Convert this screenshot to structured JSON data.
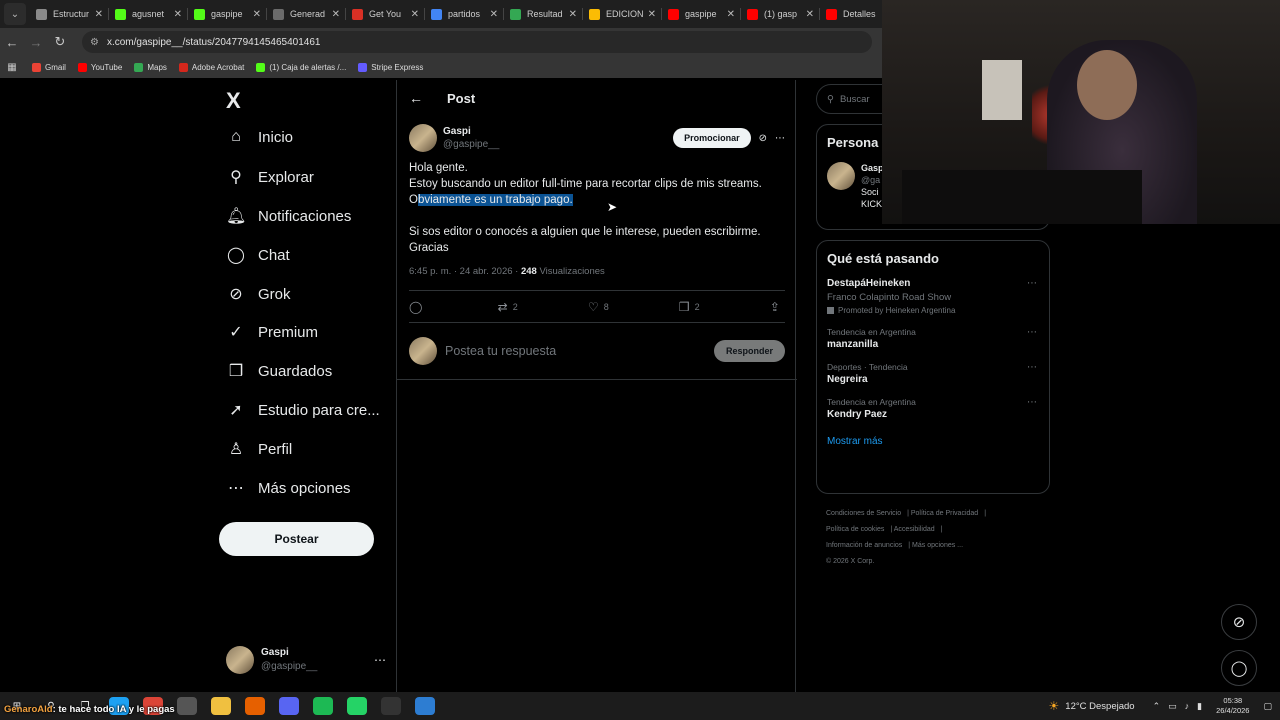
{
  "browser": {
    "tabs": [
      {
        "title": "Estructur",
        "color": "#8a8a8a"
      },
      {
        "title": "agusnet",
        "color": "#53fc18"
      },
      {
        "title": "gaspipe",
        "color": "#53fc18"
      },
      {
        "title": "Generad",
        "color": "#6b6b6b"
      },
      {
        "title": "Get You",
        "color": "#d93025"
      },
      {
        "title": "partidos",
        "color": "#4285f4"
      },
      {
        "title": "Resultad",
        "color": "#34a853"
      },
      {
        "title": "EDICION",
        "color": "#fbbc04"
      },
      {
        "title": "gaspipe",
        "color": "#ff0000"
      },
      {
        "title": "(1) gasp",
        "color": "#ff0000"
      },
      {
        "title": "Detalles",
        "color": "#ff0000"
      }
    ],
    "url": "x.com/gaspipe__/status/2047794145465401461",
    "bookmarks": [
      {
        "label": "Gmail",
        "color": "#ea4335"
      },
      {
        "label": "YouTube",
        "color": "#ff0000"
      },
      {
        "label": "Maps",
        "color": "#34a853"
      },
      {
        "label": "Adobe Acrobat",
        "color": "#d4271c"
      },
      {
        "label": "(1) Caja de alertas /...",
        "color": "#53fc18"
      },
      {
        "label": "Stripe Express",
        "color": "#635bff"
      }
    ]
  },
  "nav": {
    "logo": "X",
    "items": [
      {
        "label": "Inicio",
        "icon": "home-icon",
        "glyph": "⌂"
      },
      {
        "label": "Explorar",
        "icon": "search-icon",
        "glyph": "⚲"
      },
      {
        "label": "Notificaciones",
        "icon": "bell-icon",
        "glyph": "🔔︎"
      },
      {
        "label": "Chat",
        "icon": "chat-icon",
        "glyph": "◯"
      },
      {
        "label": "Grok",
        "icon": "grok-icon",
        "glyph": "⊘"
      },
      {
        "label": "Premium",
        "icon": "verified-icon",
        "glyph": "✓"
      },
      {
        "label": "Guardados",
        "icon": "bookmark-icon",
        "glyph": "❒"
      },
      {
        "label": "Estudio para cre...",
        "icon": "rocket-icon",
        "glyph": "➚"
      },
      {
        "label": "Perfil",
        "icon": "person-icon",
        "glyph": "♙"
      },
      {
        "label": "Más opciones",
        "icon": "more-circle-icon",
        "glyph": "⋯"
      }
    ],
    "post_button": "Postear",
    "account": {
      "name": "Gaspi",
      "handle": "@gaspipe__"
    }
  },
  "post": {
    "header": "Post",
    "author": {
      "name": "Gaspi",
      "handle": "@gaspipe__"
    },
    "promote": "Promocionar",
    "lines": {
      "l1": "Hola gente.",
      "l2": "Estoy buscando un editor full-time para recortar clips de mis streams.",
      "l3a": "O",
      "l3b": "bviamente es un trabajo pago.",
      "l4": "Si sos editor o conocés a alguien que le interese, pueden escribirme.",
      "l5": "Gracias"
    },
    "meta_time": "6:45 p. m. · 24 abr. 2026 · ",
    "meta_views_count": "248",
    "meta_views_label": " Visualizaciones",
    "actions": {
      "reposts": "2",
      "likes": "8",
      "bookmarks": "2"
    },
    "reply_placeholder": "Postea tu respuesta",
    "reply_button": "Responder"
  },
  "sidebar": {
    "search_placeholder": "Buscar",
    "personas_title": "Persona",
    "persona": {
      "name": "Gasp",
      "handle": "@ga",
      "l1": "Soci",
      "l2": "KICK"
    },
    "trends_title": "Qué está pasando",
    "trends": [
      {
        "context": "",
        "name": "DestapáHeineken",
        "sub": "Franco Colapinto Road Show",
        "promo": "Promoted by Heineken Argentina"
      },
      {
        "context": "Tendencia en Argentina",
        "name": "manzanilla"
      },
      {
        "context": "Deportes · Tendencia",
        "name": "Negreira"
      },
      {
        "context": "Tendencia en Argentina",
        "name": "Kendry Paez"
      }
    ],
    "show_more": "Mostrar más",
    "footer": {
      "f1": "Condiciones de Servicio",
      "f2": "Política de Privacidad",
      "f3": "Política de cookies",
      "f4": "Accesibilidad",
      "f5": "Información de anuncios",
      "f6": "Más opciones ...",
      "f7": "© 2026 X Corp."
    }
  },
  "taskbar": {
    "overlay_user": "GenaroAld",
    "overlay_text": ": te hace todo IA y le pagas",
    "weather": "12°C  Despejado",
    "time": "05:38",
    "date": "26/4/2026"
  }
}
